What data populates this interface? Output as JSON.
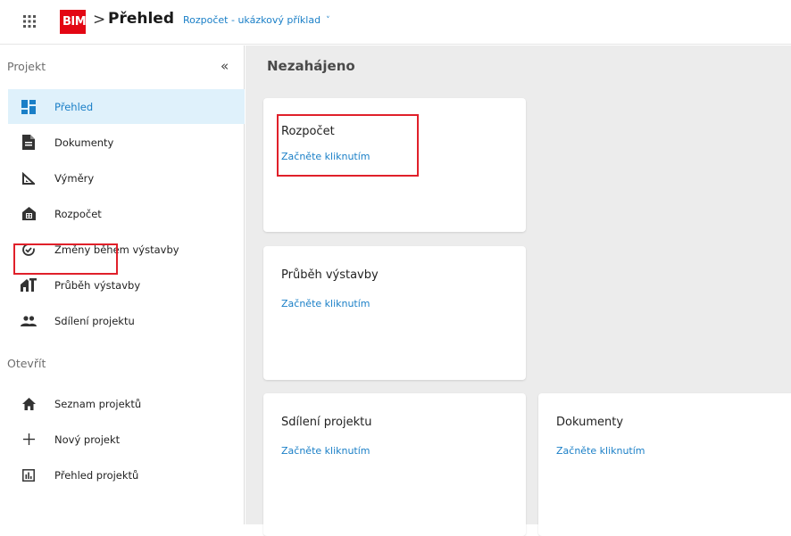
{
  "header": {
    "apps_icon": "apps-grid-icon",
    "logo_text": "BIM",
    "breadcrumb_separator": ">",
    "title": "Přehled",
    "project_name": "Rozpočet - ukázkový příklad",
    "project_chevron": "˅"
  },
  "sidebar": {
    "section_project": "Projekt",
    "collapse_icon": "«",
    "project_items": [
      {
        "label": "Přehled",
        "icon": "dashboard-icon",
        "active": true
      },
      {
        "label": "Dokumenty",
        "icon": "document-icon"
      },
      {
        "label": "Výměry",
        "icon": "ruler-triangle-icon"
      },
      {
        "label": "Rozpočet",
        "icon": "budget-building-icon"
      },
      {
        "label": "Změny během výstavby",
        "icon": "change-cycle-icon"
      },
      {
        "label": "Průběh výstavby",
        "icon": "construction-progress-icon"
      },
      {
        "label": "Sdílení projektu",
        "icon": "people-icon"
      }
    ],
    "section_open": "Otevřít",
    "open_items": [
      {
        "label": "Seznam projektů",
        "icon": "home-icon"
      },
      {
        "label": "Nový projekt",
        "icon": "plus-icon"
      },
      {
        "label": "Přehled projektů",
        "icon": "bar-chart-icon"
      }
    ]
  },
  "main": {
    "heading": "Nezahájeno",
    "cards": [
      {
        "title": "Rozpočet",
        "link": "Začněte kliknutím"
      },
      {
        "title": "Průběh výstavby",
        "link": "Začněte kliknutím"
      },
      {
        "title": "Sdílení projektu",
        "link": "Začněte kliknutím"
      },
      {
        "title": "Dokumenty",
        "link": "Začněte kliknutím"
      }
    ]
  },
  "colors": {
    "accent": "#1a7fc7",
    "active_bg": "#dff1fb",
    "brand_red": "#e30613",
    "annotation_red": "#e0202a",
    "main_bg": "#ececec"
  }
}
